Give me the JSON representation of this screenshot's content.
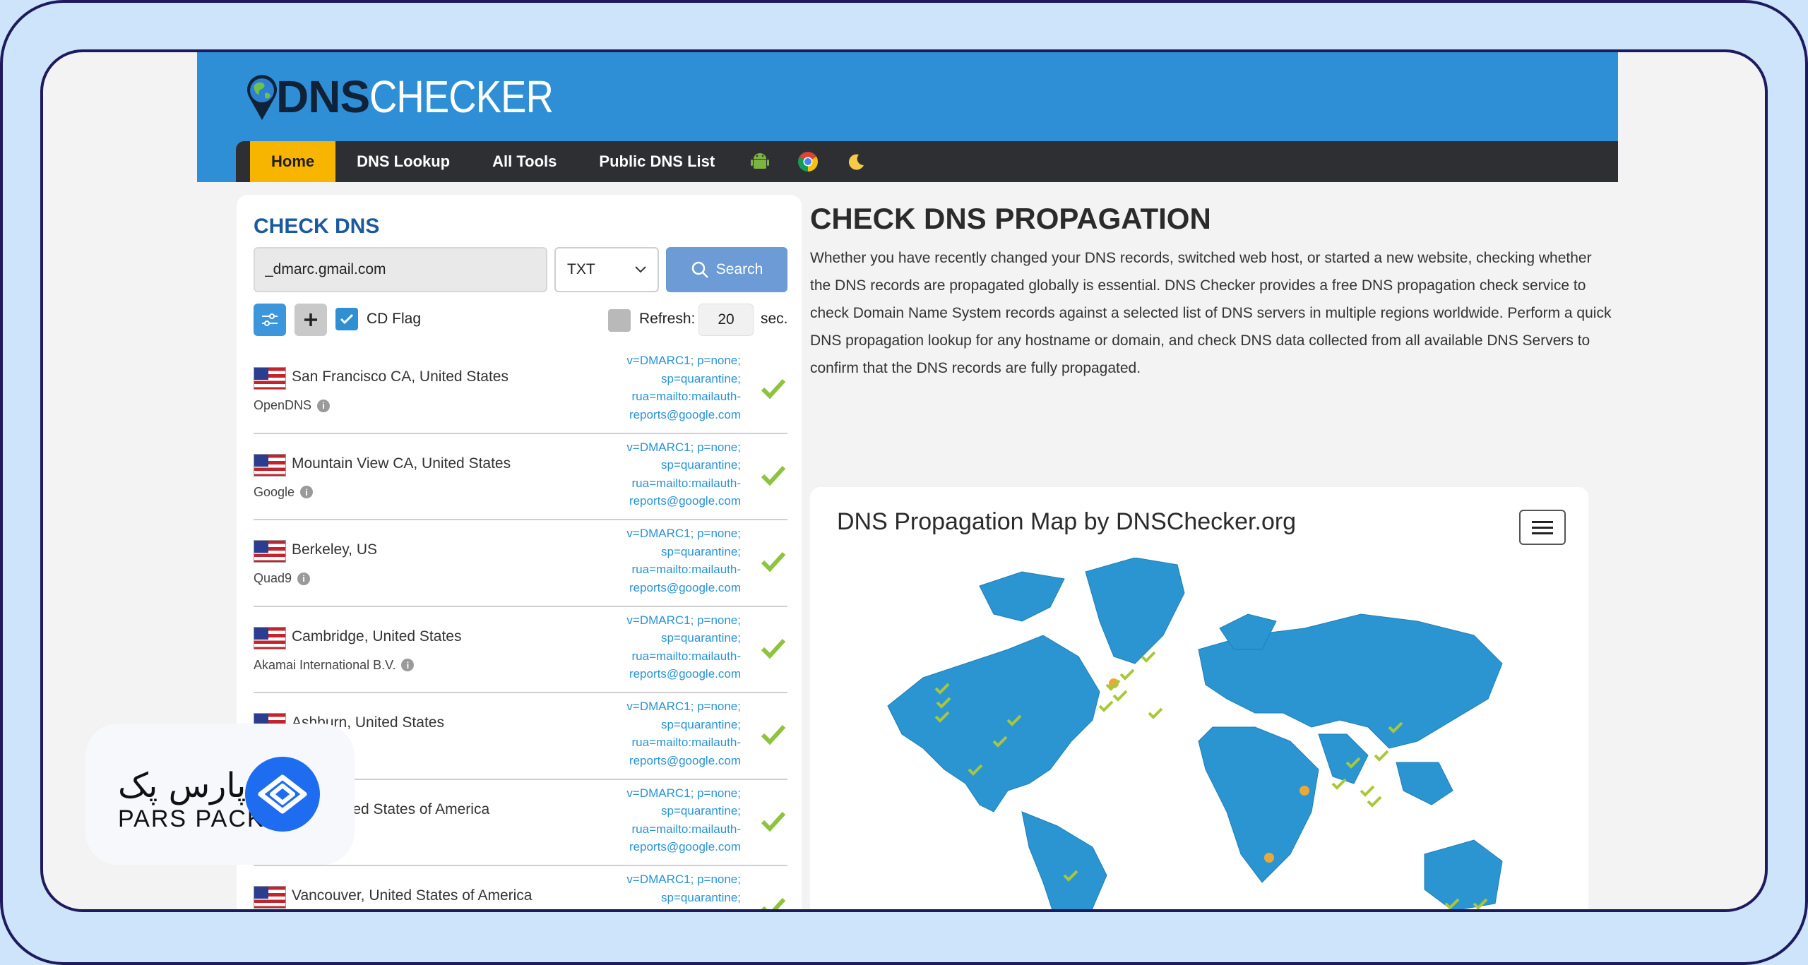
{
  "logo": {
    "dns": "DNS",
    "checker": "CHECKER"
  },
  "nav": {
    "items": [
      "Home",
      "DNS Lookup",
      "All Tools",
      "Public DNS List"
    ],
    "icons": [
      "android-icon",
      "chrome-icon",
      "moon-icon"
    ]
  },
  "check_dns": {
    "title": "CHECK DNS",
    "domain": "_dmarc.gmail.com",
    "record_type": "TXT",
    "search_label": "Search",
    "cd_flag_label": "CD Flag",
    "refresh_label": "Refresh:",
    "refresh_value": "20",
    "refresh_unit": "sec."
  },
  "results": [
    {
      "location": "San Francisco CA, United States",
      "provider": "OpenDNS",
      "record": "v=DMARC1; p=none; sp=quarantine; rua=mailto:mailauth-reports@google.com"
    },
    {
      "location": "Mountain View CA, United States",
      "provider": "Google",
      "record": "v=DMARC1; p=none; sp=quarantine; rua=mailto:mailauth-reports@google.com"
    },
    {
      "location": "Berkeley, US",
      "provider": "Quad9",
      "record": "v=DMARC1; p=none; sp=quarantine; rua=mailto:mailauth-reports@google.com"
    },
    {
      "location": "Cambridge, United States",
      "provider": "Akamai International B.V.",
      "record": "v=DMARC1; p=none; sp=quarantine; rua=mailto:mailauth-reports@google.com"
    },
    {
      "location": "Ashburn, United States",
      "provider": "",
      "record": "v=DMARC1; p=none; sp=quarantine; rua=mailto:mailauth-reports@google.com"
    },
    {
      "location": "isco, United States of America",
      "provider": "",
      "record": "v=DMARC1; p=none; sp=quarantine; rua=mailto:mailauth-reports@google.com"
    },
    {
      "location": "Vancouver, United States of America",
      "provider": "",
      "record": "v=DMARC1; p=none; sp=quarantine;"
    }
  ],
  "propagation": {
    "title": "CHECK DNS PROPAGATION",
    "description": "Whether you have recently changed your DNS records, switched web host, or started a new website, checking whether the DNS records are propagated globally is essential. DNS Checker provides a free DNS propagation check service to check Domain Name System records against a selected list of DNS servers in multiple regions worldwide. Perform a quick DNS propagation lookup for any hostname or domain, and check DNS data collected from all available DNS Servers to confirm that the DNS records are fully propagated."
  },
  "map": {
    "title": "DNS Propagation Map by DNSChecker.org"
  },
  "brand": {
    "fa": "پارس پک",
    "en": "PARS PACK"
  },
  "colors": {
    "header": "#2e8fd6",
    "nav": "#2d2f33",
    "active": "#f7b500",
    "accent": "#1c5aa0",
    "record": "#2893d4",
    "tick": "#8dc33f",
    "brand": "#1e6df0"
  }
}
